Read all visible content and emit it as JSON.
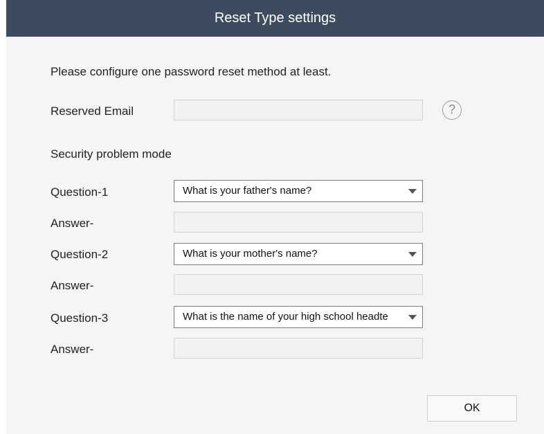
{
  "dialog": {
    "title": "Reset Type settings",
    "instruction": "Please configure one password reset method at least.",
    "email": {
      "label": "Reserved Email",
      "value": "",
      "help_icon": "question-circle-icon",
      "help_glyph": "?"
    },
    "section_title": "Security problem mode",
    "questions": [
      {
        "label": "Question-1",
        "selected": "What is your father's name?",
        "answer_label": "Answer-",
        "answer_value": ""
      },
      {
        "label": "Question-2",
        "selected": "What is your mother's name?",
        "answer_label": "Answer-",
        "answer_value": ""
      },
      {
        "label": "Question-3",
        "selected": "What is the name of your high school headte",
        "answer_label": "Answer-",
        "answer_value": ""
      }
    ],
    "ok_label": "OK"
  },
  "colors": {
    "titlebar": "#3d4b5f",
    "background": "#f5f5f5",
    "field_fill": "#f2f2f2"
  }
}
